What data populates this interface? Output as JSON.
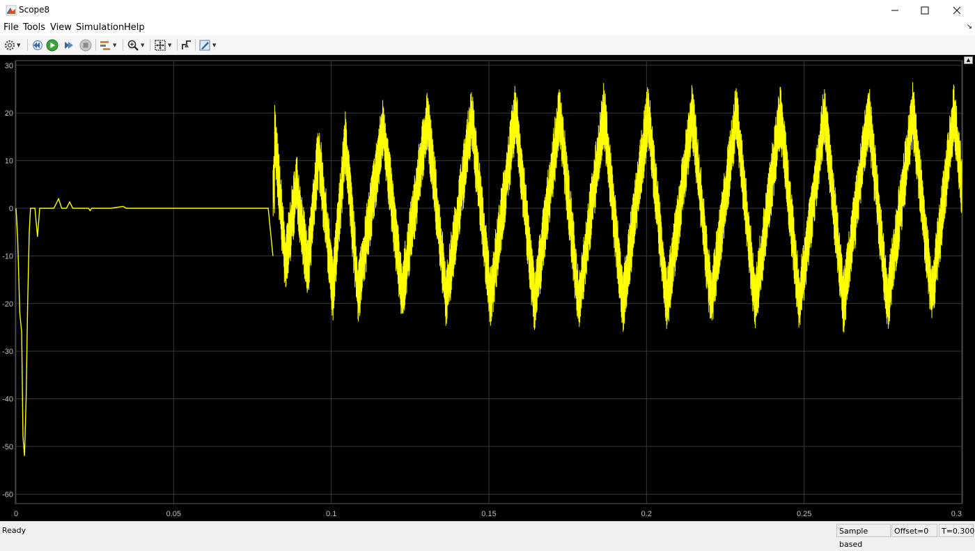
{
  "window": {
    "title": "Scope8"
  },
  "menu": [
    {
      "label": "File"
    },
    {
      "label": "Tools"
    },
    {
      "label": "View"
    },
    {
      "label": "Simulation"
    },
    {
      "label": "Help"
    }
  ],
  "toolbar": {
    "icons": [
      "gear-icon",
      "step-back-icon",
      "run-icon",
      "step-forward-icon",
      "stop-icon",
      "highlight-icon",
      "zoom-icon",
      "autoscale-icon",
      "triggers-icon",
      "style-icon"
    ]
  },
  "status": {
    "ready": "Ready",
    "mode": "Sample based",
    "offset": "Offset=0",
    "time": "T=0.300"
  },
  "colors": {
    "trace": "#ffff00",
    "background": "#000000",
    "grid": "#3a3a3a",
    "ticks": "#c0c0c0"
  },
  "chart_data": {
    "type": "line",
    "xlim": [
      0,
      0.3
    ],
    "ylim": [
      -62,
      31
    ],
    "x_ticks": [
      "0",
      "0.05",
      "0.1",
      "0.15",
      "0.2",
      "0.25",
      "0.3"
    ],
    "x_tick_values": [
      0,
      0.05,
      0.1,
      0.15,
      0.2,
      0.25,
      0.3
    ],
    "y_ticks": [
      "30",
      "20",
      "10",
      "0",
      "-10",
      "-20",
      "-30",
      "-40",
      "-50",
      "-60"
    ],
    "y_tick_values": [
      30,
      20,
      10,
      0,
      -10,
      -20,
      -30,
      -40,
      -50,
      -60
    ],
    "grid": true,
    "series": [
      {
        "color": "#ffff00",
        "transient": [
          [
            0,
            0
          ],
          [
            0.0005,
            -6
          ],
          [
            0.0012,
            -22
          ],
          [
            0.0018,
            -26
          ],
          [
            0.0022,
            -48
          ],
          [
            0.0027,
            -52
          ],
          [
            0.0032,
            -40
          ],
          [
            0.0037,
            -20
          ],
          [
            0.0042,
            -5
          ],
          [
            0.0046,
            0
          ],
          [
            0.006,
            0
          ],
          [
            0.0068,
            -6
          ],
          [
            0.0075,
            0
          ],
          [
            0.012,
            0
          ],
          [
            0.0135,
            2
          ],
          [
            0.0145,
            0
          ],
          [
            0.016,
            0
          ],
          [
            0.017,
            1.3
          ],
          [
            0.018,
            0
          ],
          [
            0.023,
            0
          ],
          [
            0.0235,
            -0.5
          ],
          [
            0.024,
            0
          ],
          [
            0.03,
            0
          ],
          [
            0.034,
            0.4
          ],
          [
            0.035,
            0
          ],
          [
            0.08,
            0
          ],
          [
            0.0815,
            -10
          ]
        ],
        "envelope_peaks": [
          [
            0.082,
            16
          ],
          [
            0.0855,
            -12
          ],
          [
            0.089,
            5
          ],
          [
            0.0925,
            -13
          ],
          [
            0.096,
            12
          ],
          [
            0.1005,
            -17
          ],
          [
            0.1045,
            14
          ],
          [
            0.1085,
            -18
          ],
          [
            0.1165,
            17
          ],
          [
            0.1225,
            -18
          ],
          [
            0.1305,
            19
          ],
          [
            0.1365,
            -19
          ],
          [
            0.1445,
            19
          ],
          [
            0.1505,
            -19
          ],
          [
            0.1585,
            20
          ],
          [
            0.1645,
            -20
          ],
          [
            0.1725,
            20
          ],
          [
            0.1785,
            -20
          ],
          [
            0.1865,
            20
          ],
          [
            0.1925,
            -20
          ],
          [
            0.2005,
            20
          ],
          [
            0.2065,
            -20
          ],
          [
            0.2145,
            20
          ],
          [
            0.2205,
            -20
          ],
          [
            0.2285,
            20
          ],
          [
            0.2345,
            -20
          ],
          [
            0.2425,
            20
          ],
          [
            0.2485,
            -20
          ],
          [
            0.2565,
            20
          ],
          [
            0.2625,
            -20
          ],
          [
            0.2705,
            20
          ],
          [
            0.2765,
            -20
          ],
          [
            0.2845,
            20
          ],
          [
            0.2905,
            -19
          ],
          [
            0.2975,
            20
          ],
          [
            0.3,
            5
          ]
        ]
      }
    ]
  }
}
